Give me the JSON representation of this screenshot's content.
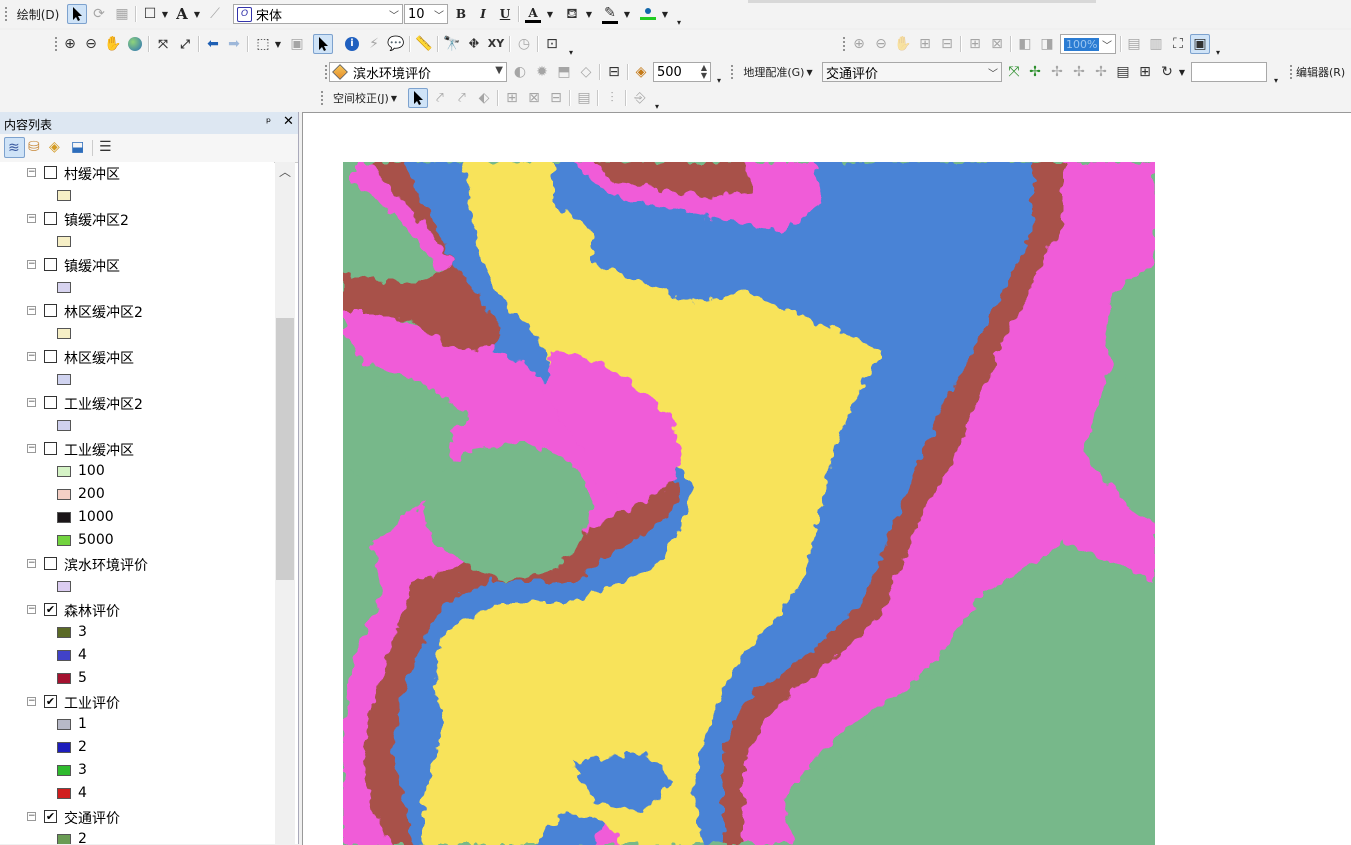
{
  "toolbar_draw": {
    "menu_label": "绘制(D)",
    "font_name": "宋体",
    "font_size": "10",
    "bold": "B",
    "italic": "I",
    "underline": "U",
    "text_tool": "A",
    "font_color_label": "A"
  },
  "toolbar_layer": {
    "active_layer": "滨水环境评价",
    "scale_value": "500",
    "georef_menu": "地理配准(G)",
    "georef_layer": "交通评价",
    "editor_menu": "编辑器(R)",
    "zoom_value": "100%"
  },
  "toolbar_spatial": {
    "adjust_menu": "空间校正(J)"
  },
  "toc": {
    "title": "内容列表",
    "pin": "ᵖ",
    "close": "✕",
    "items": [
      {
        "type": "layer",
        "label": "村缓冲区",
        "checked": false
      },
      {
        "type": "legend",
        "label": "",
        "color": "#f6efc6"
      },
      {
        "type": "layer",
        "label": "镇缓冲区2",
        "checked": false
      },
      {
        "type": "legend",
        "label": "",
        "color": "#f6efc6"
      },
      {
        "type": "layer",
        "label": "镇缓冲区",
        "checked": false
      },
      {
        "type": "legend",
        "label": "",
        "color": "#d7d3ef"
      },
      {
        "type": "layer",
        "label": "林区缓冲区2",
        "checked": false
      },
      {
        "type": "legend",
        "label": "",
        "color": "#f6efc6"
      },
      {
        "type": "layer",
        "label": "林区缓冲区",
        "checked": false
      },
      {
        "type": "legend",
        "label": "",
        "color": "#d0d3f0"
      },
      {
        "type": "layer",
        "label": "工业缓冲区2",
        "checked": false
      },
      {
        "type": "legend",
        "label": "",
        "color": "#cfd0ee"
      },
      {
        "type": "layer",
        "label": "工业缓冲区",
        "checked": false
      },
      {
        "type": "legend",
        "label": "100",
        "color": "#d5f3c6"
      },
      {
        "type": "legend",
        "label": "200",
        "color": "#f4cfc5"
      },
      {
        "type": "legend",
        "label": "1000",
        "color": "#1a1518"
      },
      {
        "type": "legend",
        "label": "5000",
        "color": "#72d33f"
      },
      {
        "type": "layer",
        "label": "滨水环境评价",
        "checked": false
      },
      {
        "type": "legend",
        "label": "",
        "color": "#dccdf1"
      },
      {
        "type": "layer",
        "label": "森林评价",
        "checked": true
      },
      {
        "type": "legend",
        "label": "3",
        "color": "#5b6a26"
      },
      {
        "type": "legend",
        "label": "4",
        "color": "#4142c8"
      },
      {
        "type": "legend",
        "label": "5",
        "color": "#a4122f"
      },
      {
        "type": "layer",
        "label": "工业评价",
        "checked": true
      },
      {
        "type": "legend",
        "label": "1",
        "color": "#b7b9c7"
      },
      {
        "type": "legend",
        "label": "2",
        "color": "#1d1dbc"
      },
      {
        "type": "legend",
        "label": "3",
        "color": "#2fba2e"
      },
      {
        "type": "legend",
        "label": "4",
        "color": "#d01d1d"
      },
      {
        "type": "layer",
        "label": "交通评价",
        "checked": true
      },
      {
        "type": "legend",
        "label": "2",
        "color": "#6a9c54"
      }
    ]
  },
  "map": {
    "colors": {
      "class_green": "#77b88a",
      "class_pink": "#f05bd8",
      "class_brown": "#a8514a",
      "class_blue": "#4a83d6",
      "class_yellow": "#f8e35a"
    }
  }
}
